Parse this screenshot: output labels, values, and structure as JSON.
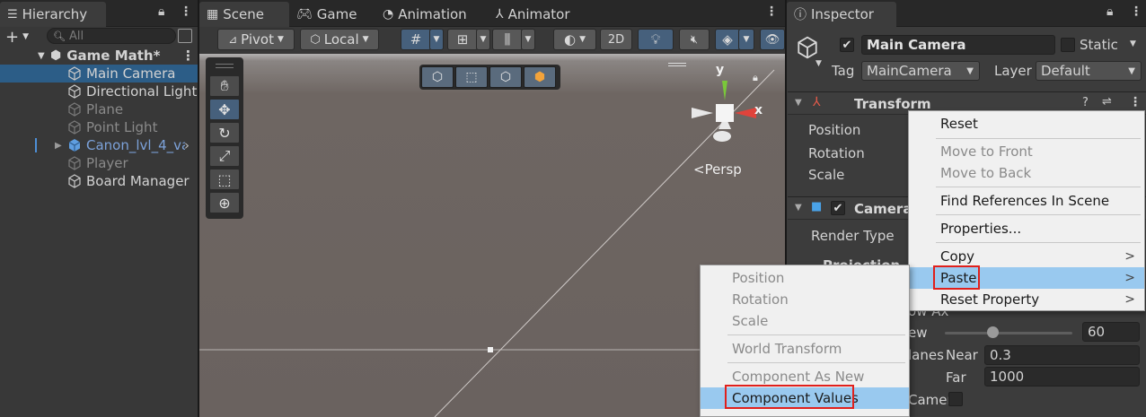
{
  "hierarchy": {
    "tab_title": "Hierarchy",
    "add_label": "+",
    "search_placeholder": "All",
    "scene_name": "Game Math*",
    "items": [
      {
        "label": "Main Camera"
      },
      {
        "label": "Directional Light"
      },
      {
        "label": "Plane"
      },
      {
        "label": "Point Light"
      },
      {
        "label": "Canon_lvl_4_va"
      },
      {
        "label": "Player"
      },
      {
        "label": "Board Manager"
      }
    ]
  },
  "tabs": {
    "scene": "Scene",
    "game": "Game",
    "animation": "Animation",
    "animator": "Animator"
  },
  "scene_toolbar": {
    "pivot": "Pivot",
    "local": "Local",
    "mode_2d": "2D"
  },
  "gizmo": {
    "y_label": "y",
    "x_label": "x",
    "persp_label": "<Persp"
  },
  "inspector": {
    "tab_title": "Inspector",
    "object_name": "Main Camera",
    "static_label": "Static",
    "tag_label": "Tag",
    "tag_value": "MainCamera",
    "layer_label": "Layer",
    "layer_value": "Default",
    "transform": {
      "title": "Transform",
      "position": "Position",
      "rotation": "Rotation",
      "scale": "Scale"
    },
    "camera": {
      "title": "Camera",
      "render_type": "Render Type",
      "projection_partial": "Projection",
      "fov_axis_partial": "ow Ax",
      "fov_partial": "ew",
      "fov_value": "60",
      "planes_partial": "lanes",
      "near_label": "Near",
      "near_value": "0.3",
      "far_label": "Far",
      "far_value": "1000",
      "camera_partial": "Camer"
    }
  },
  "context_menu": {
    "items": [
      "Reset",
      "Move to Front",
      "Move to Back",
      "Find References In Scene",
      "Properties...",
      "Copy",
      "Paste",
      "Reset Property"
    ],
    "arrow": ">"
  },
  "paste_submenu": {
    "items": [
      "Position",
      "Rotation",
      "Scale",
      "World Transform",
      "Component As New",
      "Component Values"
    ]
  }
}
